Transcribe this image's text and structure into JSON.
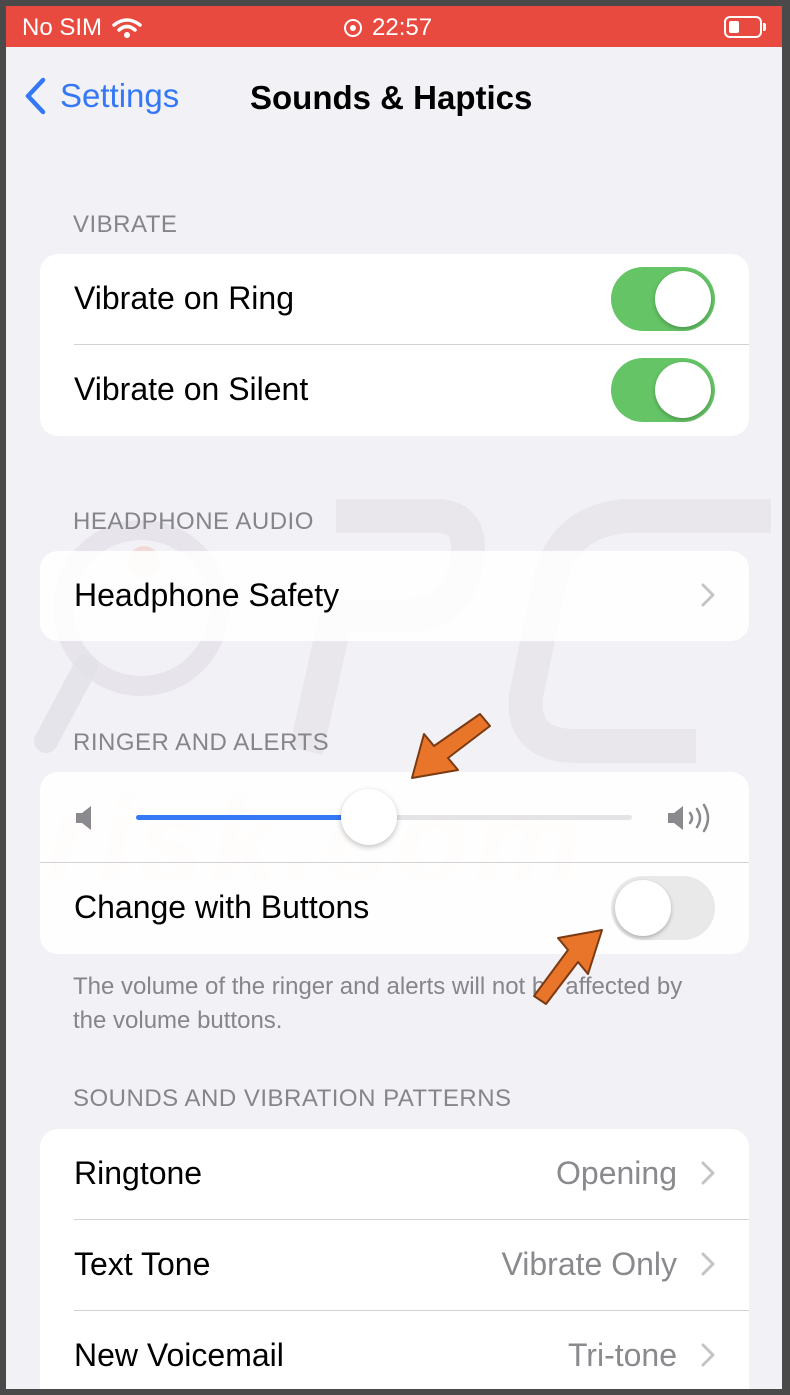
{
  "status_bar": {
    "carrier": "No SIM",
    "time": "22:57"
  },
  "nav": {
    "back_label": "Settings",
    "title": "Sounds & Haptics"
  },
  "sections": {
    "vibrate": {
      "header": "VIBRATE",
      "rows": [
        {
          "label": "Vibrate on Ring",
          "on": true
        },
        {
          "label": "Vibrate on Silent",
          "on": true
        }
      ]
    },
    "headphone": {
      "header": "HEADPHONE AUDIO",
      "rows": [
        {
          "label": "Headphone Safety"
        }
      ]
    },
    "ringer": {
      "header": "RINGER AND ALERTS",
      "volume_fraction": 0.47,
      "change_with_buttons": {
        "label": "Change with Buttons",
        "on": false
      },
      "footer": "The volume of the ringer and alerts will not be affected by the volume buttons."
    },
    "patterns": {
      "header": "SOUNDS AND VIBRATION PATTERNS",
      "rows": [
        {
          "label": "Ringtone",
          "value": "Opening"
        },
        {
          "label": "Text Tone",
          "value": "Vibrate Only"
        },
        {
          "label": "New Voicemail",
          "value": "Tri-tone"
        }
      ]
    }
  },
  "colors": {
    "status_bar_bg": "#e84a3f",
    "accent": "#3478f6",
    "toggle_on": "#65c466",
    "annotation_arrow": "#e8752a"
  }
}
